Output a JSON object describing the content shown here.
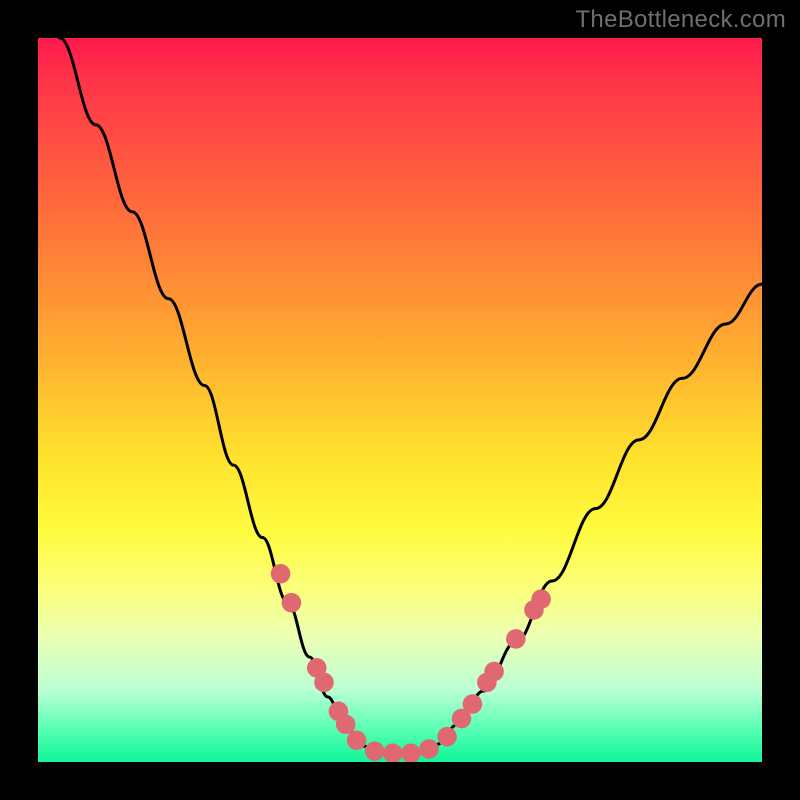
{
  "watermark": "TheBottleneck.com",
  "chart_data": {
    "type": "line",
    "title": "",
    "xlabel": "",
    "ylabel": "",
    "xlim": [
      0,
      100
    ],
    "ylim": [
      0,
      100
    ],
    "background_gradient_stops": [
      {
        "pos": 0,
        "color": "#ff1a4d"
      },
      {
        "pos": 6,
        "color": "#ff3449"
      },
      {
        "pos": 18,
        "color": "#ff5a3f"
      },
      {
        "pos": 33,
        "color": "#ff8a36"
      },
      {
        "pos": 46,
        "color": "#ffb72f"
      },
      {
        "pos": 58,
        "color": "#ffe22e"
      },
      {
        "pos": 68,
        "color": "#fffb3e"
      },
      {
        "pos": 76,
        "color": "#fcff7a"
      },
      {
        "pos": 83,
        "color": "#e9ffb4"
      },
      {
        "pos": 90,
        "color": "#bbffd4"
      },
      {
        "pos": 96,
        "color": "#4fffb0"
      },
      {
        "pos": 100,
        "color": "#10f59a"
      }
    ],
    "series": [
      {
        "name": "bottleneck-curve",
        "stroke": "#000000",
        "points": [
          {
            "x": 3,
            "y": 100
          },
          {
            "x": 8,
            "y": 88
          },
          {
            "x": 13,
            "y": 76
          },
          {
            "x": 18,
            "y": 64
          },
          {
            "x": 23,
            "y": 52
          },
          {
            "x": 27,
            "y": 41
          },
          {
            "x": 31,
            "y": 31
          },
          {
            "x": 34.5,
            "y": 22
          },
          {
            "x": 37.5,
            "y": 14.5
          },
          {
            "x": 40,
            "y": 9
          },
          {
            "x": 42.5,
            "y": 4.8
          },
          {
            "x": 45,
            "y": 2.2
          },
          {
            "x": 47.5,
            "y": 1.2
          },
          {
            "x": 50,
            "y": 1.2
          },
          {
            "x": 52.5,
            "y": 1.2
          },
          {
            "x": 55,
            "y": 2.4
          },
          {
            "x": 58,
            "y": 5.2
          },
          {
            "x": 61.5,
            "y": 9.8
          },
          {
            "x": 66,
            "y": 16.6
          },
          {
            "x": 71,
            "y": 25
          },
          {
            "x": 77,
            "y": 35
          },
          {
            "x": 83,
            "y": 44.5
          },
          {
            "x": 89,
            "y": 53
          },
          {
            "x": 95,
            "y": 60.5
          },
          {
            "x": 100,
            "y": 66
          }
        ]
      }
    ],
    "markers": {
      "color": "#e06971",
      "radius_pct": 1.35,
      "points": [
        {
          "x": 33.5,
          "y": 26
        },
        {
          "x": 35.0,
          "y": 22
        },
        {
          "x": 38.5,
          "y": 13
        },
        {
          "x": 39.5,
          "y": 11
        },
        {
          "x": 41.5,
          "y": 7
        },
        {
          "x": 42.5,
          "y": 5.2
        },
        {
          "x": 44.0,
          "y": 3.0
        },
        {
          "x": 46.5,
          "y": 1.5
        },
        {
          "x": 49.0,
          "y": 1.2
        },
        {
          "x": 51.5,
          "y": 1.2
        },
        {
          "x": 54.0,
          "y": 1.8
        },
        {
          "x": 56.5,
          "y": 3.5
        },
        {
          "x": 58.5,
          "y": 6.0
        },
        {
          "x": 60.0,
          "y": 8.0
        },
        {
          "x": 62.0,
          "y": 11.0
        },
        {
          "x": 63.0,
          "y": 12.5
        },
        {
          "x": 66.0,
          "y": 17.0
        },
        {
          "x": 68.5,
          "y": 21.0
        },
        {
          "x": 69.5,
          "y": 22.5
        }
      ]
    }
  }
}
